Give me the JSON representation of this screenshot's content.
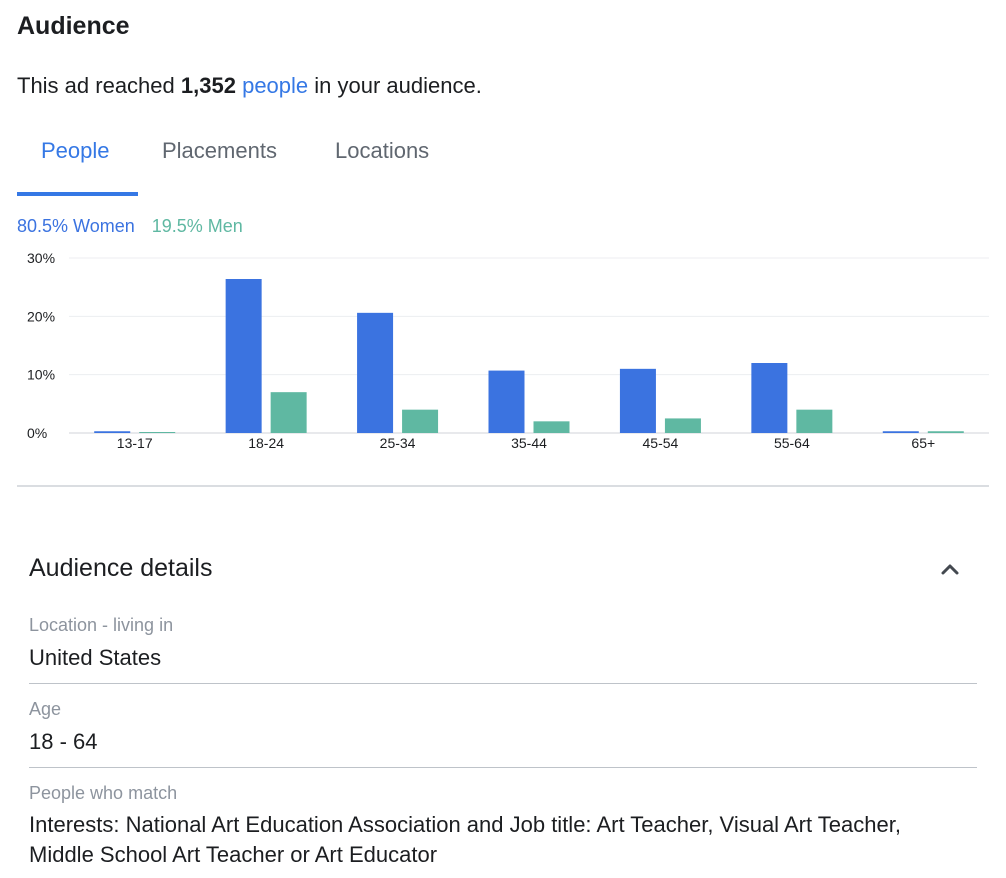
{
  "header": {
    "title": "Audience"
  },
  "reach": {
    "prefix": "This ad reached",
    "count": "1,352",
    "link": "people",
    "suffix": "in your audience."
  },
  "tabs": [
    {
      "label": "People"
    },
    {
      "label": "Placements"
    },
    {
      "label": "Locations"
    }
  ],
  "legend": {
    "women": "80.5% Women",
    "men": "19.5% Men"
  },
  "colors": {
    "accent": "#3578e5",
    "women": "#3b73e0",
    "men": "#5fb8a2"
  },
  "chart_data": {
    "type": "bar",
    "categories": [
      "13-17",
      "18-24",
      "25-34",
      "35-44",
      "45-54",
      "55-64",
      "65+"
    ],
    "series": [
      {
        "name": "Women",
        "values": [
          0.3,
          26.4,
          20.6,
          10.7,
          11.0,
          12.0,
          0.3
        ]
      },
      {
        "name": "Men",
        "values": [
          0.1,
          7.0,
          4.0,
          2.0,
          2.5,
          4.0,
          0.3
        ]
      }
    ],
    "yticks": [
      "0%",
      "10%",
      "20%",
      "30%"
    ],
    "ylim": [
      0,
      30
    ],
    "grid": true
  },
  "details": {
    "title": "Audience details",
    "collapse_icon": "chevron-up-icon",
    "fields": [
      {
        "label": "Location - living in",
        "value": "United States"
      },
      {
        "label": "Age",
        "value": "18 - 64"
      },
      {
        "label": "People who match",
        "value": "Interests: National Art Education Association and Job title: Art Teacher, Visual Art Teacher, Middle School Art Teacher or Art Educator"
      }
    ]
  }
}
